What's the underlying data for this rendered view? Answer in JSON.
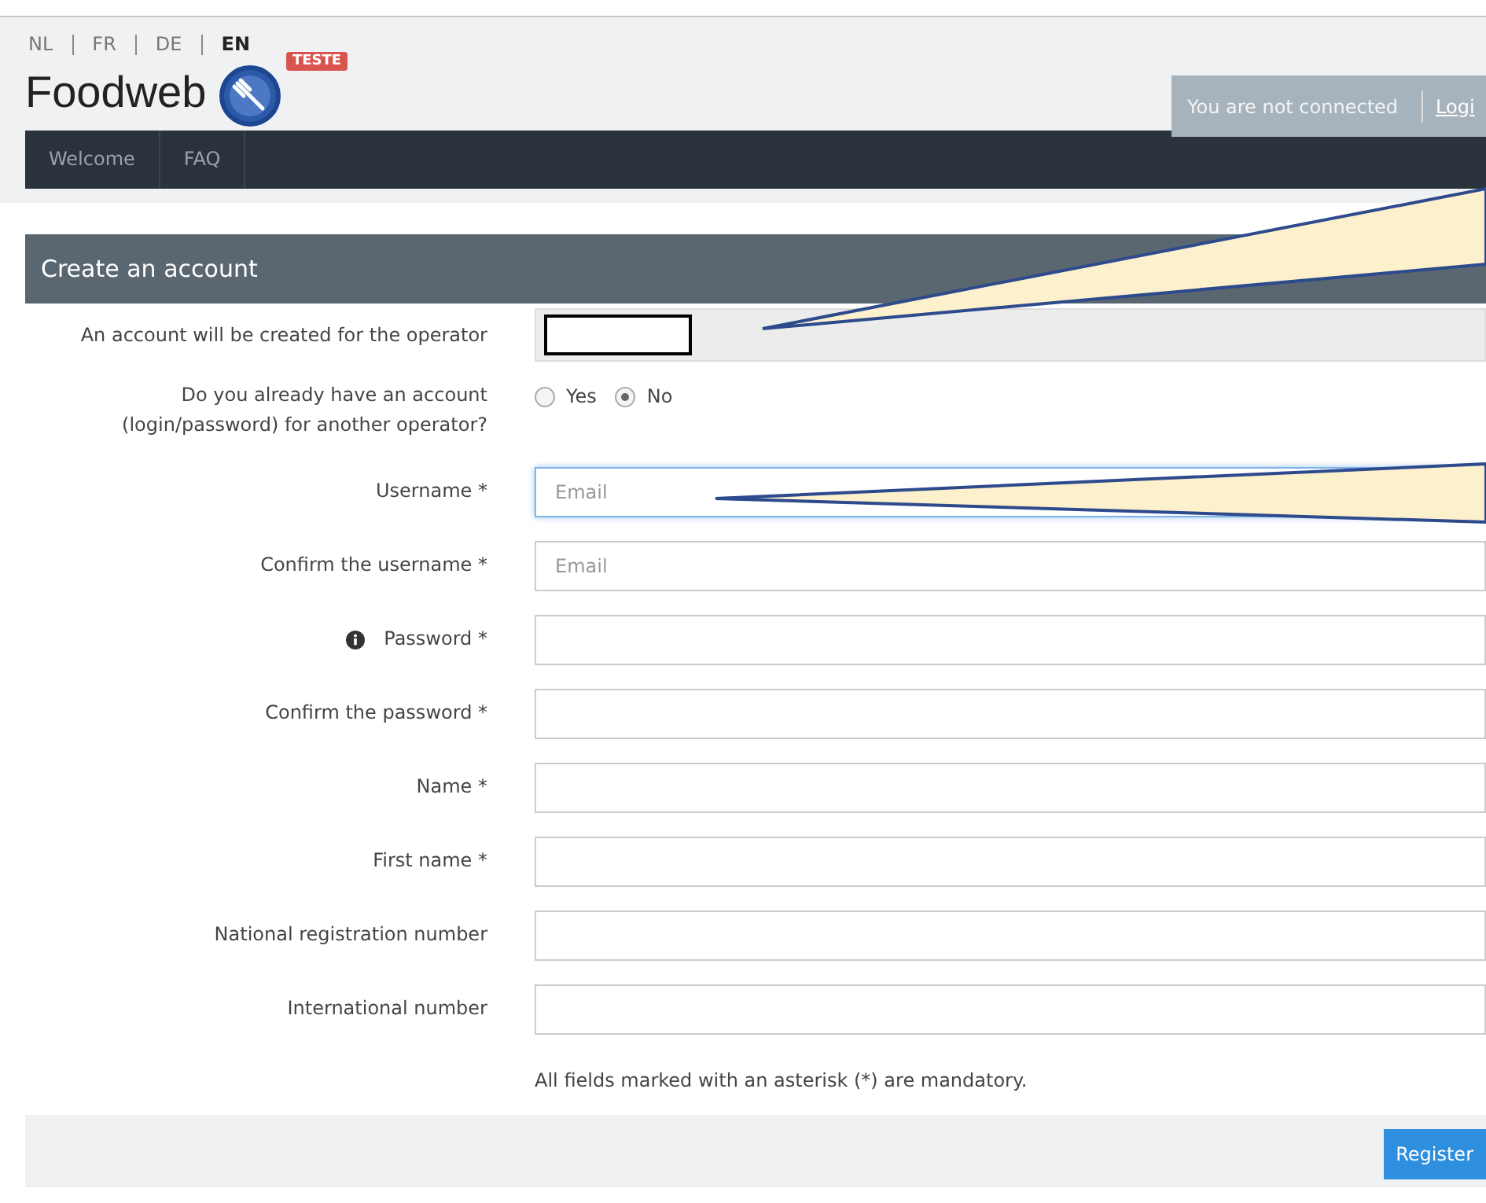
{
  "languages": [
    {
      "label": "NL",
      "selected": false
    },
    {
      "label": "FR",
      "selected": false
    },
    {
      "label": "DE",
      "selected": false
    },
    {
      "label": "EN",
      "selected": true
    }
  ],
  "brand": {
    "name": "Foodweb",
    "badge": "TESTE"
  },
  "session": {
    "status": "You are not connected",
    "link": "Logi"
  },
  "nav": [
    {
      "label": "Welcome"
    },
    {
      "label": "FAQ"
    }
  ],
  "form": {
    "title": "Create an account",
    "rows": [
      {
        "kind": "readonly",
        "label": "An account will be created for the operator"
      },
      {
        "kind": "radio",
        "label": "Do you already have an account (login/password) for another operator?",
        "options": [
          {
            "label": "Yes",
            "selected": false
          },
          {
            "label": "No",
            "selected": true
          }
        ]
      },
      {
        "kind": "input",
        "label": "Username *",
        "placeholder": "Email",
        "focused": true
      },
      {
        "kind": "input",
        "label": "Confirm the username *",
        "placeholder": "Email",
        "focused": false
      },
      {
        "kind": "input",
        "label": "Password *",
        "info": true,
        "focused": false
      },
      {
        "kind": "input",
        "label": "Confirm the password *",
        "focused": false
      },
      {
        "kind": "input",
        "label": "Name *",
        "focused": false
      },
      {
        "kind": "input",
        "label": "First name *",
        "focused": false
      },
      {
        "kind": "input",
        "label": "National registration number",
        "focused": false
      },
      {
        "kind": "input",
        "label": "International number",
        "focused": false
      }
    ],
    "note": "All fields marked with an asterisk (*) are mandatory.",
    "submit": "Register"
  }
}
